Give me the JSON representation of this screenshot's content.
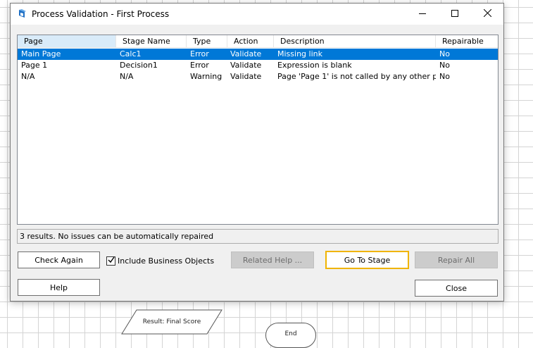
{
  "window": {
    "title": "Process Validation - First Process"
  },
  "columns": [
    "Page",
    "Stage Name",
    "Type",
    "Action",
    "Description",
    "Repairable"
  ],
  "rows": [
    {
      "page": "Main Page",
      "stage": "Calc1",
      "type": "Error",
      "action": "Validate",
      "description": "Missing link",
      "repairable": "No"
    },
    {
      "page": "Page 1",
      "stage": "Decision1",
      "type": "Error",
      "action": "Validate",
      "description": "Expression is blank",
      "repairable": "No"
    },
    {
      "page": "N/A",
      "stage": "N/A",
      "type": "Warning",
      "action": "Validate",
      "description": "Page 'Page 1' is not called by any other p...",
      "repairable": "No"
    }
  ],
  "status": "3 results. No issues can be automatically repaired",
  "buttons": {
    "check_again": "Check Again",
    "include_business_objects": "Include Business Objects",
    "related_help": "Related Help ...",
    "go_to_stage": "Go To Stage",
    "repair_all": "Repair All",
    "help": "Help",
    "close": "Close"
  },
  "include_business_objects_checked": true,
  "canvas": {
    "result_shape_label": "Result: Final Score",
    "end_shape_label": "End"
  },
  "colors": {
    "selection": "#0078d7",
    "focus_border": "#f0b400",
    "sorted_header": "#d9ebf9"
  },
  "icons": [
    "app-icon",
    "minimize-icon",
    "maximize-icon",
    "close-icon",
    "checkmark-icon"
  ]
}
